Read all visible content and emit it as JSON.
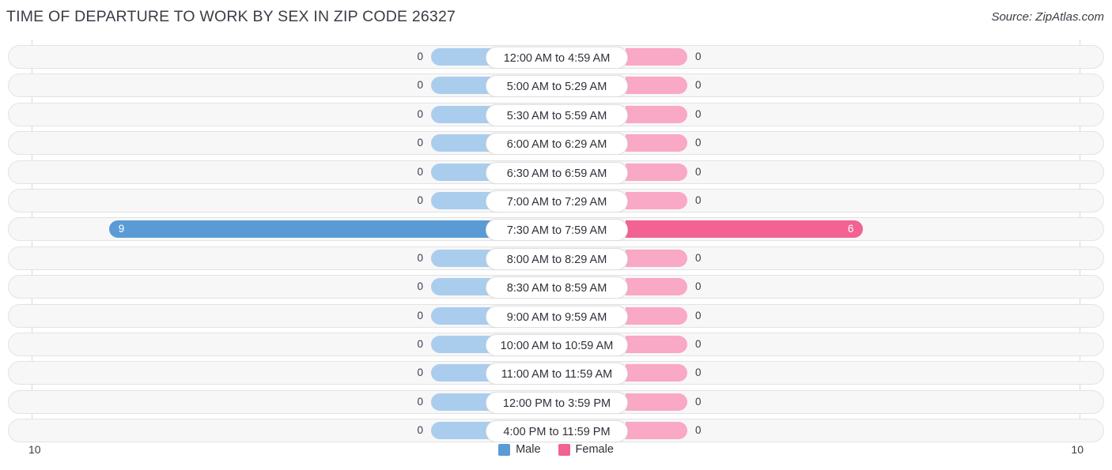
{
  "header": {
    "title": "TIME OF DEPARTURE TO WORK BY SEX IN ZIP CODE 26327",
    "source": "Source: ZipAtlas.com"
  },
  "axis": {
    "left_max_label": "10",
    "right_max_label": "10"
  },
  "legend": {
    "items": [
      {
        "label": "Male",
        "color": "#5b9bd5"
      },
      {
        "label": "Female",
        "color": "#f26292"
      }
    ]
  },
  "colors": {
    "male_active": "#5b9bd5",
    "male_muted": "#aacdee",
    "female_active": "#f26292",
    "female_muted": "#f9a8c5",
    "row_track": "#f7f7f7",
    "row_border": "#e3e3e3",
    "gridline": "#d9d9d9",
    "text": "#3c3c46"
  },
  "chart_data": {
    "type": "bar",
    "subtype": "diverging-bar",
    "title": "TIME OF DEPARTURE TO WORK BY SEX IN ZIP CODE 26327",
    "xlabel": "",
    "ylabel": "",
    "xlim": [
      0,
      10
    ],
    "grid": true,
    "legend_position": "bottom-center",
    "categories": [
      "12:00 AM to 4:59 AM",
      "5:00 AM to 5:29 AM",
      "5:30 AM to 5:59 AM",
      "6:00 AM to 6:29 AM",
      "6:30 AM to 6:59 AM",
      "7:00 AM to 7:29 AM",
      "7:30 AM to 7:59 AM",
      "8:00 AM to 8:29 AM",
      "8:30 AM to 8:59 AM",
      "9:00 AM to 9:59 AM",
      "10:00 AM to 10:59 AM",
      "11:00 AM to 11:59 AM",
      "12:00 PM to 3:59 PM",
      "4:00 PM to 11:59 PM"
    ],
    "series": [
      {
        "name": "Male",
        "color": "#5b9bd5",
        "direction": "left",
        "values": [
          0,
          0,
          0,
          0,
          0,
          0,
          9,
          0,
          0,
          0,
          0,
          0,
          0,
          0
        ]
      },
      {
        "name": "Female",
        "color": "#f26292",
        "direction": "right",
        "values": [
          0,
          0,
          0,
          0,
          0,
          0,
          6,
          0,
          0,
          0,
          0,
          0,
          0,
          0
        ]
      }
    ]
  }
}
